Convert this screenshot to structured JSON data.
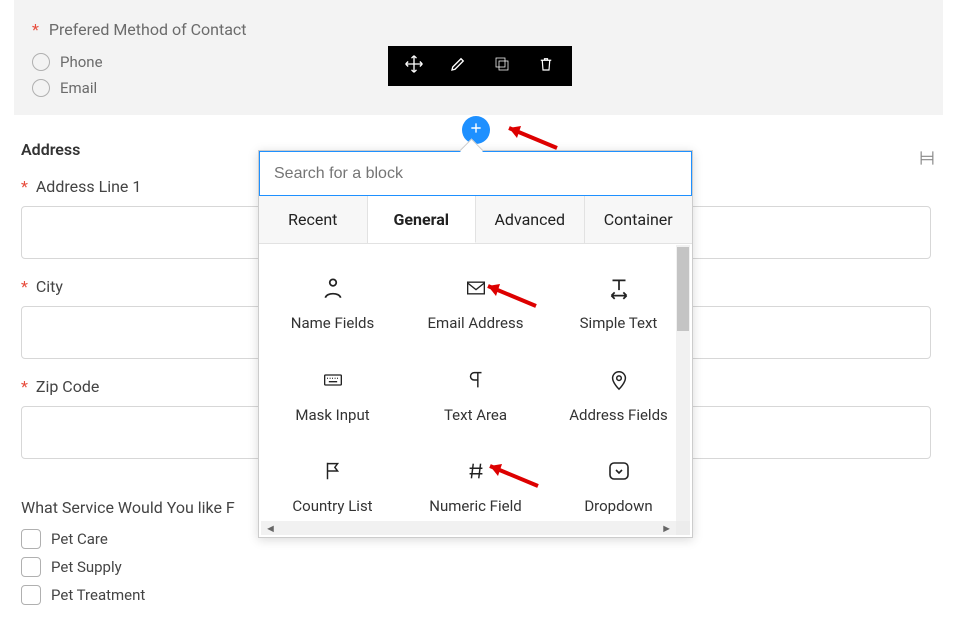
{
  "radio_group": {
    "heading": "Prefered Method of Contact",
    "options": [
      "Phone",
      "Email"
    ]
  },
  "toolbar": {
    "items": [
      "move",
      "edit",
      "duplicate",
      "delete"
    ]
  },
  "address": {
    "section_title": "Address",
    "line1_label": "Address Line 1",
    "city_label": "City",
    "zip_label": "Zip Code"
  },
  "services": {
    "question": "What Service Would You like F",
    "options": [
      "Pet Care",
      "Pet Supply",
      "Pet Treatment"
    ]
  },
  "popover": {
    "search_placeholder": "Search for a block",
    "tabs": [
      "Recent",
      "General",
      "Advanced",
      "Container"
    ],
    "active_tab": 1,
    "blocks": [
      {
        "id": "name-fields",
        "label": "Name Fields",
        "icon": "person"
      },
      {
        "id": "email-address",
        "label": "Email Address",
        "icon": "envelope"
      },
      {
        "id": "simple-text",
        "label": "Simple Text",
        "icon": "textwidth"
      },
      {
        "id": "mask-input",
        "label": "Mask Input",
        "icon": "keyboard"
      },
      {
        "id": "text-area",
        "label": "Text Area",
        "icon": "paragraph"
      },
      {
        "id": "address-fields",
        "label": "Address Fields",
        "icon": "pin"
      },
      {
        "id": "country-list",
        "label": "Country List",
        "icon": "flag"
      },
      {
        "id": "numeric-field",
        "label": "Numeric Field",
        "icon": "hash"
      },
      {
        "id": "dropdown",
        "label": "Dropdown",
        "icon": "chevboxed"
      }
    ]
  }
}
